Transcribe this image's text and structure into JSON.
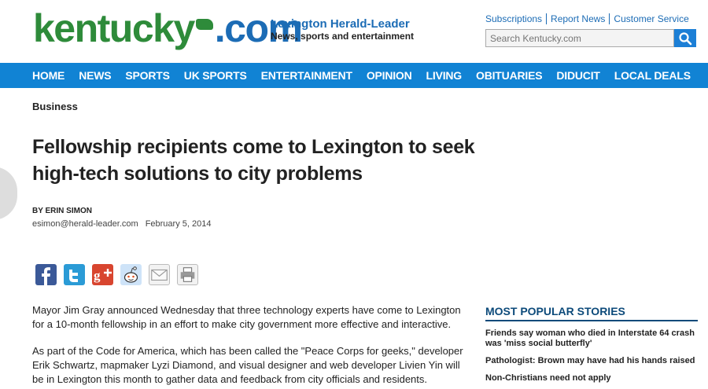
{
  "header": {
    "logo_part1": "kentucky",
    "logo_part2": ".com",
    "tagline_title": "Lexington Herald-Leader",
    "tagline_sub": "News, sports and entertainment",
    "util_links": [
      "Subscriptions",
      "Report News",
      "Customer Service"
    ],
    "search_placeholder": "Search Kentucky.com"
  },
  "nav": {
    "items": [
      "HOME",
      "NEWS",
      "SPORTS",
      "UK SPORTS",
      "ENTERTAINMENT",
      "OPINION",
      "LIVING",
      "OBITUARIES",
      "DIDUCIT",
      "LOCAL DEALS"
    ]
  },
  "article": {
    "section": "Business",
    "headline": "Fellowship recipients come to Lexington to seek high-tech solutions to city problems",
    "byline": "BY ERIN SIMON",
    "email": "esimon@herald-leader.com",
    "date": "February 5, 2014",
    "paragraphs": [
      "Mayor Jim Gray announced Wednesday that three technology experts have come to Lexington for a 10-month fellowship in an effort to make city government more effective and interactive.",
      "As part of the Code for America, which has been called the \"Peace Corps for geeks,\" developer Erik Schwartz, mapmaker Lyzi Diamond, and visual designer and web developer Livien Yin will be in Lexington this month to gather data and feedback from city officials and residents."
    ]
  },
  "share": {
    "icons": [
      "facebook-icon",
      "twitter-icon",
      "google-plus-icon",
      "reddit-icon",
      "email-icon",
      "print-icon"
    ]
  },
  "popular": {
    "title": "MOST POPULAR STORIES",
    "items": [
      "Friends say woman who died in Interstate 64 crash was 'miss social butterfly'",
      "Pathologist: Brown may have had his hands raised",
      "Non-Christians need not apply"
    ]
  },
  "colors": {
    "nav_bg": "#1183d4",
    "logo_green": "#2e8b3a",
    "logo_blue": "#1c6cb5",
    "popular_title": "#0c4a7a"
  }
}
